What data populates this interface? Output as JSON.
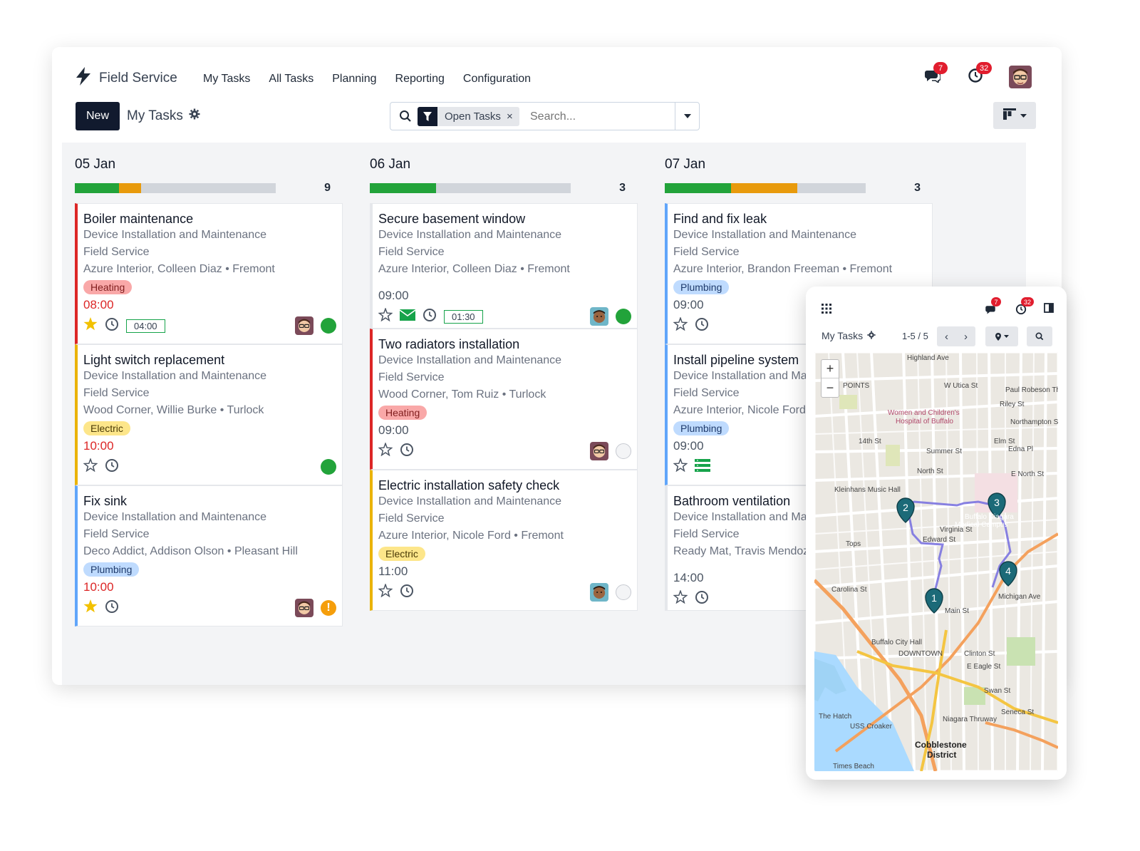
{
  "app": {
    "name": "Field Service",
    "menu": [
      "My Tasks",
      "All Tasks",
      "Planning",
      "Reporting",
      "Configuration"
    ],
    "messages_count": "7",
    "activities_count": "32"
  },
  "control": {
    "new_label": "New",
    "view_title": "My Tasks",
    "filter_facet": "Open Tasks",
    "search_placeholder": "Search..."
  },
  "colors": {
    "brand": "#111a2e",
    "done": "#22a33a",
    "in_progress": "#e89a0c",
    "badge": "#e11d2e"
  },
  "columns": [
    {
      "date": "05 Jan",
      "count": "9",
      "progress": {
        "green": 0.22,
        "orange": 0.11
      },
      "cards": [
        {
          "title": "Boiler maintenance",
          "project": "Device Installation and Maintenance",
          "service": "Field Service",
          "customer": "Azure Interior, Colleen Diaz • Fremont",
          "tag": "Heating",
          "time": "08:00",
          "duration": "04:00",
          "starred": true,
          "status": "green"
        },
        {
          "title": "Light switch replacement",
          "project": "Device Installation and Maintenance",
          "service": "Field Service",
          "customer": "Wood Corner, Willie Burke • Turlock",
          "tag": "Electric",
          "time": "10:00",
          "starred": false,
          "status": "green"
        },
        {
          "title": "Fix sink",
          "project": "Device Installation and Maintenance",
          "service": "Field Service",
          "customer": "Deco Addict, Addison Olson • Pleasant Hill",
          "tag": "Plumbing",
          "time": "10:00",
          "starred": true,
          "status": "warning"
        }
      ]
    },
    {
      "date": "06 Jan",
      "count": "3",
      "progress": {
        "green": 0.33,
        "orange": 0
      },
      "cards": [
        {
          "title": "Secure basement window",
          "project": "Device Installation and Maintenance",
          "service": "Field Service",
          "customer": "Azure Interior, Colleen Diaz • Fremont",
          "time": "09:00",
          "duration": "01:30",
          "starred": false,
          "status": "green"
        },
        {
          "title": "Two radiators installation",
          "project": "Device Installation and Maintenance",
          "service": "Field Service",
          "customer": "Wood Corner, Tom Ruiz • Turlock",
          "tag": "Heating",
          "time": "09:00",
          "starred": false,
          "status": "grey"
        },
        {
          "title": "Electric installation safety check",
          "project": "Device Installation and Maintenance",
          "service": "Field Service",
          "customer": "Azure Interior, Nicole Ford • Fremont",
          "tag": "Electric",
          "time": "11:00",
          "starred": false,
          "status": "grey"
        }
      ]
    },
    {
      "date": "07 Jan",
      "count": "3",
      "progress": {
        "green": 0.33,
        "orange": 0.33
      },
      "cards": [
        {
          "title": "Find and fix leak",
          "project": "Device Installation and Maintenance",
          "service": "Field Service",
          "customer": "Azure Interior, Brandon Freeman • Fremont",
          "tag": "Plumbing",
          "time": "09:00",
          "starred": false
        },
        {
          "title": "Install pipeline system",
          "project": "Device Installation and Maintenance",
          "service": "Field Service",
          "customer": "Azure Interior, Nicole Ford • Fremont",
          "tag": "Plumbing",
          "time": "09:00",
          "starred": false
        },
        {
          "title": "Bathroom ventilation",
          "project": "Device Installation and Maintenance",
          "service": "Field Service",
          "customer": "Ready Mat, Travis Mendoza • Fremont",
          "time": "14:00",
          "starred": false
        }
      ]
    }
  ],
  "mobile": {
    "title": "My Tasks",
    "pager": "1-5 / 5",
    "messages_count": "7",
    "activities_count": "32",
    "map_labels": [
      "Highland Ave",
      "W Utica St",
      "Paul Robeson Th",
      "Riley St",
      "Women and Children's",
      "Hospital of Buffalo",
      "Northampton St",
      "Summer St",
      "Edna Pl",
      "North St",
      "E North St",
      "Kleinhans Music Hall",
      "Virginia St",
      "Edward St",
      "Buffalo Niagara",
      "Medical Campus",
      "Tops",
      "Carolina St",
      "Buffalo City Hall",
      "DOWNTOWN",
      "Clinton St",
      "E Eagle St",
      "Swan St",
      "Seneca St",
      "Niagara Thruway",
      "The Hatch",
      "USS Croaker",
      "Cobblestone",
      "District",
      "Times Beach",
      "POINTS",
      "14th St",
      "Main St",
      "Michigan Ave",
      "Elm St"
    ],
    "pins": [
      "1",
      "2",
      "3",
      "4"
    ]
  }
}
